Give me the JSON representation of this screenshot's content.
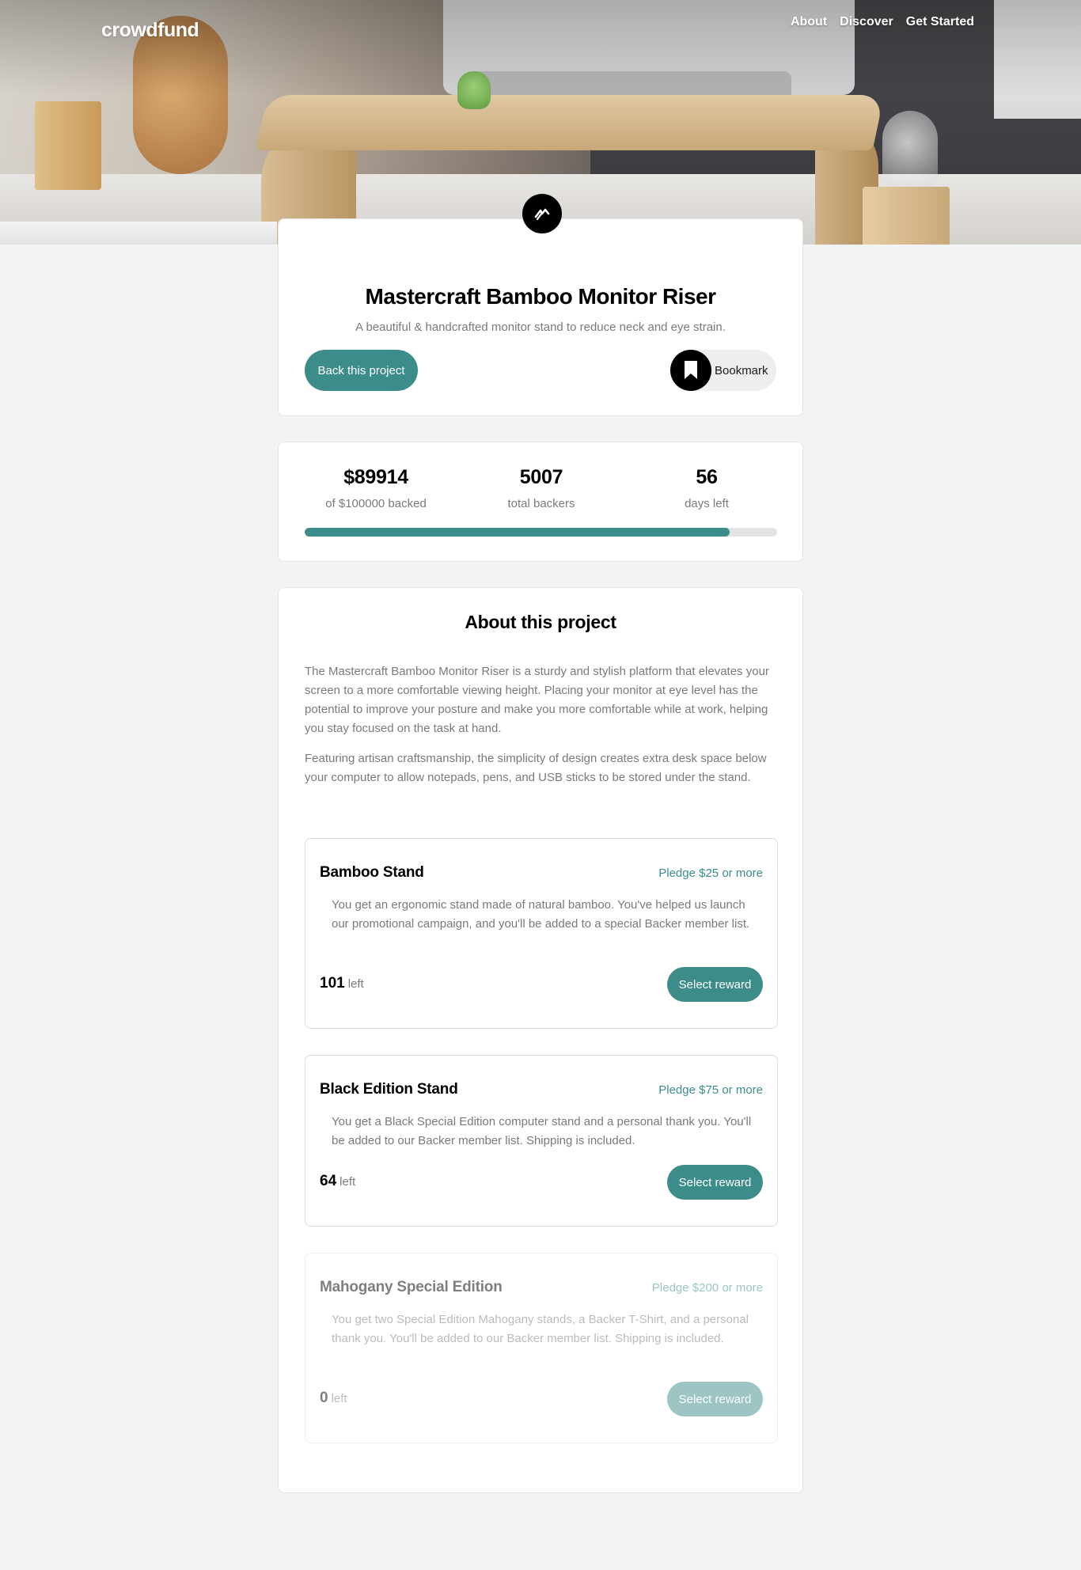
{
  "header": {
    "logo": "crowdfund",
    "nav": [
      "About",
      "Discover",
      "Get Started"
    ]
  },
  "project": {
    "title": "Mastercraft Bamboo Monitor Riser",
    "subtitle": "A beautiful & handcrafted monitor stand to reduce neck and eye strain.",
    "back_label": "Back this project",
    "bookmark_label": "Bookmark"
  },
  "stats": {
    "backed_value": "$89914",
    "backed_label": "of $100000 backed",
    "backers_value": "5007",
    "backers_label": "total backers",
    "days_value": "56",
    "days_label": "days left",
    "progress": 0.89914
  },
  "about": {
    "title": "About this project",
    "paragraphs": [
      "The Mastercraft Bamboo Monitor Riser is a sturdy and stylish platform that elevates your screen to a more comfortable viewing height. Placing your monitor at eye level has the potential to improve your posture and make you more comfortable while at work, helping you stay focused on the task at hand.",
      "Featuring artisan craftsmanship, the simplicity of design creates extra desk space below your computer to allow notepads, pens, and USB sticks to be stored under the stand."
    ]
  },
  "rewards": [
    {
      "name": "Bamboo Stand",
      "pledge": "Pledge $25 or more",
      "description": "You get an ergonomic stand made of natural bamboo. You've helped us launch our promotional campaign, and you'll be added to a special Backer member list.",
      "left": "101",
      "left_label": "left",
      "button": "Select reward"
    },
    {
      "name": "Black Edition Stand",
      "pledge": "Pledge $75 or more",
      "description": "You get a Black Special Edition computer stand and a personal thank you. You'll be added to our Backer member list. Shipping is included.",
      "left": "64",
      "left_label": "left",
      "button": "Select reward"
    },
    {
      "name": "Mahogany Special Edition",
      "pledge": "Pledge $200 or more",
      "description": "You get two Special Edition Mahogany stands, a Backer T-Shirt, and a personal thank you. You'll be added to our Backer member list. Shipping is included.",
      "left": "0",
      "left_label": "left",
      "button": "Select reward"
    }
  ],
  "colors": {
    "accent": "#3c8c89",
    "background": "#f2f3f4"
  }
}
